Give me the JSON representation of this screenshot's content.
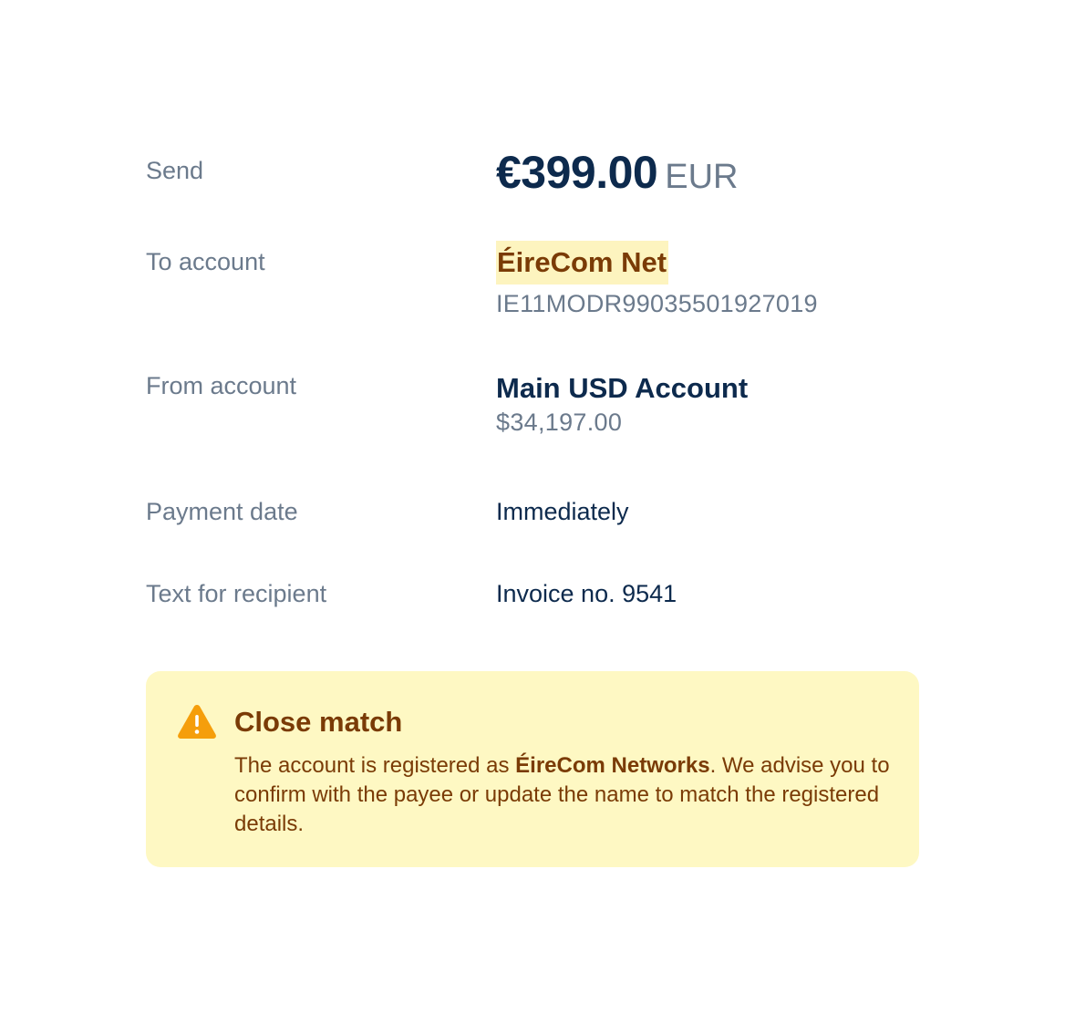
{
  "send": {
    "label": "Send",
    "amount": "€399.00",
    "currency": "EUR"
  },
  "to_account": {
    "label": "To account",
    "payee_name": "ÉireCom Net",
    "iban": "IE11MODR99035501927019"
  },
  "from_account": {
    "label": "From account",
    "account_name": "Main USD Account",
    "balance": "$34,197.00"
  },
  "payment_date": {
    "label": "Payment date",
    "value": "Immediately"
  },
  "recipient_text": {
    "label": "Text for recipient",
    "value": "Invoice no. 9541"
  },
  "alert": {
    "icon": "warning-icon",
    "title": "Close match",
    "body_prefix": "The account is registered as ",
    "registered_name": "ÉireCom Networks",
    "body_suffix": ". We advise you to confirm with the payee or update the name to match the registered details."
  },
  "colors": {
    "primary_text": "#0d2a4d",
    "muted_text": "#6b7a8c",
    "warning_text": "#7a3b06",
    "warning_bg": "#fef8c3",
    "highlight_bg": "#fdf4bf",
    "warning_icon": "#f59e0b"
  }
}
